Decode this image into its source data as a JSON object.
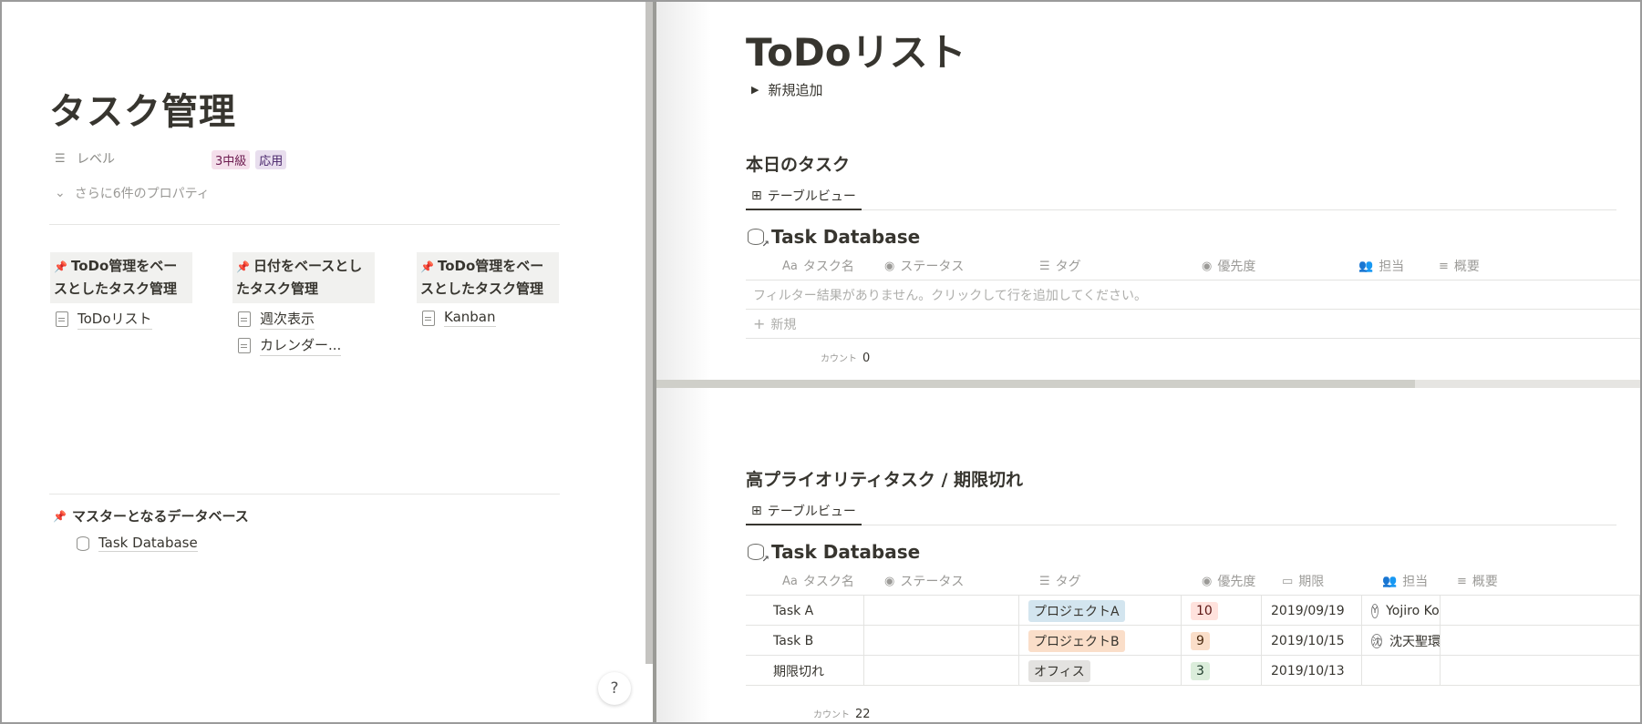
{
  "left": {
    "title": "タスク管理",
    "prop_level_label": "レベル",
    "prop_level_tags": [
      {
        "label": "3中級",
        "bg": "#f4dfeb",
        "color": "#6c1b4f"
      },
      {
        "label": "応用",
        "bg": "#e8deee",
        "color": "#452268"
      }
    ],
    "more_props": "さらに6件のプロパティ",
    "columns": [
      {
        "callout": "ToDo管理をベースとしたタスク管理",
        "links": [
          "ToDoリスト"
        ]
      },
      {
        "callout": "日付をベースとしたタスク管理",
        "links": [
          "週次表示",
          "カレンダー..."
        ]
      },
      {
        "callout": "ToDo管理をベースとしたタスク管理",
        "links": [
          "Kanban"
        ]
      }
    ],
    "master_title": "マスターとなるデータベース",
    "master_link": "Task Database",
    "help": "?"
  },
  "right": {
    "title": "ToDoリスト",
    "toggle": "新規追加",
    "section1": {
      "title": "本日のタスク",
      "tab": "テーブルビュー",
      "db_title": "Task Database",
      "headers": [
        "タスク名",
        "ステータス",
        "タグ",
        "優先度",
        "担当",
        "概要"
      ],
      "empty": "フィルター結果がありません。クリックして行を追加してください。",
      "new": "新規",
      "count_label": "カウント",
      "count": "0"
    },
    "section2": {
      "title": "高プライオリティタスク / 期限切れ",
      "tab": "テーブルビュー",
      "db_title": "Task Database",
      "headers": [
        "タスク名",
        "ステータス",
        "タグ",
        "優先度",
        "期限",
        "担当",
        "概要"
      ],
      "rows": [
        {
          "name": "Task A",
          "tag": "プロジェクトA",
          "tag_bg": "#d3e5ef",
          "priority": "10",
          "pri_bg": "#ffe2dd",
          "pri_color": "#5d1715",
          "due": "2019/09/19",
          "owner": "Yojiro Kond",
          "owner_initial": "Y"
        },
        {
          "name": "Task B",
          "tag": "プロジェクトB",
          "tag_bg": "#fadec9",
          "priority": "9",
          "pri_bg": "#fadec9",
          "pri_color": "#49290e",
          "due": "2019/10/15",
          "owner": "沈天聖環",
          "owner_initial": "沈"
        },
        {
          "name": "期限切れ",
          "tag": "オフィス",
          "tag_bg": "#e3e2e0",
          "priority": "3",
          "pri_bg": "#dbeddb",
          "pri_color": "#1c3829",
          "due": "2019/10/13",
          "owner": "",
          "owner_initial": ""
        }
      ],
      "count_label": "カウント",
      "count": "22"
    }
  }
}
